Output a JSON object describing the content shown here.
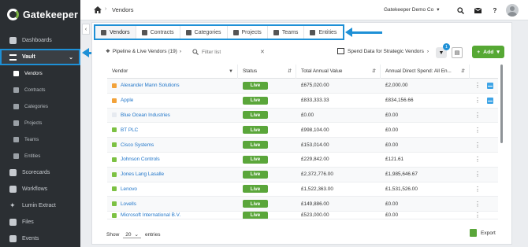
{
  "brand": {
    "name": "Gatekeeper"
  },
  "sidebar": {
    "items": [
      {
        "label": "Dashboards",
        "icon": "dashboard-icon"
      },
      {
        "label": "Vault",
        "icon": "vault-icon",
        "expanded": true
      },
      {
        "label": "Scorecards",
        "icon": "scorecard-icon"
      },
      {
        "label": "Workflows",
        "icon": "workflow-icon"
      },
      {
        "label": "Lumin Extract",
        "icon": "sparkle-icon"
      },
      {
        "label": "Files",
        "icon": "files-icon"
      },
      {
        "label": "Events",
        "icon": "calendar-icon"
      }
    ],
    "vault_sub": [
      "Vendors",
      "Contracts",
      "Categories",
      "Projects",
      "Teams",
      "Entities"
    ]
  },
  "header": {
    "breadcrumb": "Vendors",
    "company": "Gatekeeper Demo Co"
  },
  "tabs": [
    {
      "label": "Vendors",
      "icon": "vendors-icon"
    },
    {
      "label": "Contracts",
      "icon": "contracts-icon"
    },
    {
      "label": "Categories",
      "icon": "categories-icon"
    },
    {
      "label": "Projects",
      "icon": "projects-icon"
    },
    {
      "label": "Teams",
      "icon": "teams-icon"
    },
    {
      "label": "Entities",
      "icon": "entities-icon"
    }
  ],
  "toolbar": {
    "pipeline": "Pipeline & Live Vendors (19)",
    "filter_placeholder": "Filter list",
    "spend": "Spend Data for Strategic Vendors",
    "filter_count": "1",
    "add": "Add"
  },
  "table": {
    "headers": [
      "Vendor",
      "Status",
      "Total Annual Value",
      "Annual Direct Spend: All En..."
    ],
    "rows": [
      {
        "vendor": "Alexander Mann Solutions",
        "color": "#f2a23a",
        "status": "Live",
        "total": "£675,020.00",
        "spend": "£2,000.00",
        "note": true
      },
      {
        "vendor": "Apple",
        "color": "#f2a23a",
        "status": "Live",
        "total": "£833,333.33",
        "spend": "£834,156.66",
        "note": true
      },
      {
        "vendor": "Blue Ocean Industries",
        "color": "#e6eaf0",
        "status": "Live",
        "total": "£0.00",
        "spend": "£0.00",
        "note": false
      },
      {
        "vendor": "BT PLC",
        "color": "#7cc143",
        "status": "Live",
        "total": "£998,104.00",
        "spend": "£0.00",
        "note": false
      },
      {
        "vendor": "Cisco Systems",
        "color": "#7cc143",
        "status": "Live",
        "total": "£153,014.00",
        "spend": "£0.00",
        "note": false
      },
      {
        "vendor": "Johnson Controls",
        "color": "#7cc143",
        "status": "Live",
        "total": "£229,842.00",
        "spend": "£121.61",
        "note": false
      },
      {
        "vendor": "Jones Lang Lasalle",
        "color": "#7cc143",
        "status": "Live",
        "total": "£2,372,776.00",
        "spend": "£1,985,646.67",
        "note": false
      },
      {
        "vendor": "Lenovo",
        "color": "#7cc143",
        "status": "Live",
        "total": "£1,522,363.00",
        "spend": "£1,531,526.00",
        "note": false
      },
      {
        "vendor": "Lovells",
        "color": "#7cc143",
        "status": "Live",
        "total": "£149,886.00",
        "spend": "£0.00",
        "note": false
      },
      {
        "vendor": "Microsoft International B.V.",
        "color": "#7cc143",
        "status": "Live",
        "total": "£523,000.00",
        "spend": "£0.00",
        "note": false
      }
    ]
  },
  "footer": {
    "show": "Show",
    "page_size": "20",
    "entries": "entries",
    "export": "Export"
  }
}
